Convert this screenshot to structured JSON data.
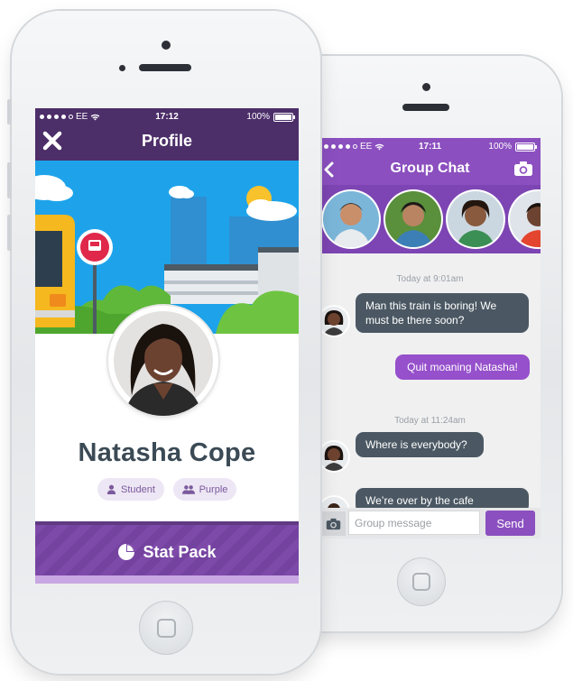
{
  "colors": {
    "profile_header": "#4c2e69",
    "chat_header": "#8b4fbf",
    "accent_purple": "#7e4aa9",
    "incoming_bubble": "#4b5863",
    "outgoing_bubble": "#9650cb",
    "sky": "#1ea3ea"
  },
  "profile_phone": {
    "status": {
      "carrier": "EE",
      "time": "17:12",
      "battery": "100%"
    },
    "header": {
      "title": "Profile",
      "close_icon": "close-icon"
    },
    "user": {
      "name": "Natasha Cope"
    },
    "badges": [
      {
        "label": "Student",
        "icon": "person-icon"
      },
      {
        "label": "Purple",
        "icon": "group-icon"
      }
    ],
    "stat_button": {
      "label": "Stat Pack",
      "icon": "pie-chart-icon"
    }
  },
  "chat_phone": {
    "status": {
      "carrier": "EE",
      "time": "17:11",
      "battery": "100%"
    },
    "header": {
      "title": "Group Chat",
      "back_icon": "chevron-left-icon",
      "camera_icon": "camera-icon"
    },
    "members_count_visible": 4,
    "messages": [
      {
        "type": "timestamp",
        "text": "Today at 9:01am"
      },
      {
        "type": "incoming",
        "text": "Man this train is boring! We must be there soon?"
      },
      {
        "type": "outgoing",
        "text": "Quit moaning Natasha!"
      },
      {
        "type": "timestamp",
        "text": "Today at 11:24am"
      },
      {
        "type": "incoming",
        "text": "Where is everybody?"
      },
      {
        "type": "incoming",
        "text": "We’re over by the cafe"
      }
    ],
    "composer": {
      "placeholder": "Group message",
      "send_label": "Send",
      "camera_icon": "camera-icon"
    }
  }
}
